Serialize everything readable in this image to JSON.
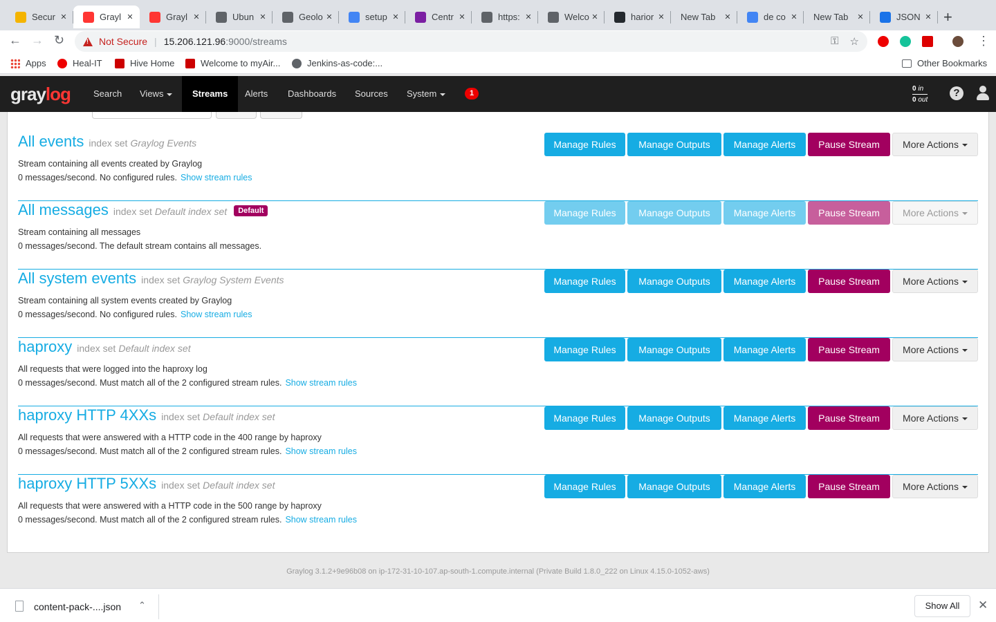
{
  "browser": {
    "tabs": [
      {
        "title": "Secur",
        "fav_color": "#f4b400",
        "active": false
      },
      {
        "title": "Grayl",
        "fav_color": "#ff3633",
        "active": true
      },
      {
        "title": "Grayl",
        "fav_color": "#ff3633",
        "active": false
      },
      {
        "title": "Ubun",
        "fav_color": "#5f6368",
        "active": false
      },
      {
        "title": "Geolo",
        "fav_color": "#5f6368",
        "active": false
      },
      {
        "title": "setup",
        "fav_color": "#4285f4",
        "active": false
      },
      {
        "title": "Centr",
        "fav_color": "#7b1fa2",
        "active": false
      },
      {
        "title": "https:",
        "fav_color": "#5f6368",
        "active": false
      },
      {
        "title": "Welco",
        "fav_color": "#5f6368",
        "active": false
      },
      {
        "title": "harior",
        "fav_color": "#24292e",
        "active": false
      },
      {
        "title": "New Tab",
        "fav_color": "",
        "active": false
      },
      {
        "title": "de co",
        "fav_color": "#4285f4",
        "active": false
      },
      {
        "title": "New Tab",
        "fav_color": "",
        "active": false
      },
      {
        "title": "JSON",
        "fav_color": "#1a73e8",
        "active": false
      }
    ],
    "new_tab_label": "+",
    "not_secure": "Not Secure",
    "url_host": "15.206.121.96",
    "url_path": ":9000/streams",
    "bookmarks": [
      {
        "label": "Apps",
        "color": "#ea4335"
      },
      {
        "label": "Heal-IT",
        "color": "#e00"
      },
      {
        "label": "Hive Home",
        "color": "#c00"
      },
      {
        "label": "Welcome to myAir...",
        "color": "#c00"
      },
      {
        "label": "Jenkins-as-code:...",
        "color": "#5f6368"
      }
    ],
    "other_bookmarks": "Other Bookmarks"
  },
  "graylog": {
    "logo_gray": "gray",
    "logo_log": "log",
    "nav": [
      {
        "label": "Search",
        "dropdown": false,
        "active": false
      },
      {
        "label": "Views",
        "dropdown": true,
        "active": false
      },
      {
        "label": "Streams",
        "dropdown": false,
        "active": true
      },
      {
        "label": "Alerts",
        "dropdown": false,
        "active": false
      },
      {
        "label": "Dashboards",
        "dropdown": false,
        "active": false
      },
      {
        "label": "Sources",
        "dropdown": false,
        "active": false
      },
      {
        "label": "System",
        "dropdown": true,
        "active": false
      }
    ],
    "notification_count": "1",
    "throughput_in_value": "0",
    "throughput_in_label": "in",
    "throughput_out_value": "0",
    "throughput_out_label": "out",
    "help_icon": "?"
  },
  "buttons": {
    "manage_rules": "Manage Rules",
    "manage_outputs": "Manage Outputs",
    "manage_alerts": "Manage Alerts",
    "pause_stream": "Pause Stream",
    "more_actions": "More Actions",
    "index_set_label": "index set",
    "show_rules": "Show stream rules"
  },
  "streams": [
    {
      "name": "All events",
      "index_set": "Graylog Events",
      "default": false,
      "desc": "Stream containing all events created by Graylog",
      "stats": "0 messages/second. No configured rules.",
      "show_rules": true,
      "disabled": false
    },
    {
      "name": "All messages",
      "index_set": "Default index set",
      "default": true,
      "desc": "Stream containing all messages",
      "stats": "0 messages/second. The default stream contains all messages.",
      "show_rules": false,
      "disabled": true
    },
    {
      "name": "All system events",
      "index_set": "Graylog System Events",
      "default": false,
      "desc": "Stream containing all system events created by Graylog",
      "stats": "0 messages/second. No configured rules.",
      "show_rules": true,
      "disabled": false
    },
    {
      "name": "haproxy",
      "index_set": "Default index set",
      "default": false,
      "desc": "All requests that were logged into the haproxy log",
      "stats": "0 messages/second. Must match all of the 2 configured stream rules.",
      "show_rules": true,
      "disabled": false
    },
    {
      "name": "haproxy HTTP 4XXs",
      "index_set": "Default index set",
      "default": false,
      "desc": "All requests that were answered with a HTTP code in the 400 range by haproxy",
      "stats": "0 messages/second. Must match all of the 2 configured stream rules.",
      "show_rules": true,
      "disabled": false
    },
    {
      "name": "haproxy HTTP 5XXs",
      "index_set": "Default index set",
      "default": false,
      "desc": "All requests that were answered with a HTTP code in the 500 range by haproxy",
      "stats": "0 messages/second. Must match all of the 2 configured stream rules.",
      "show_rules": true,
      "disabled": false
    }
  ],
  "default_badge": "Default",
  "footer": "Graylog 3.1.2+9e96b08 on ip-172-31-10-107.ap-south-1.compute.internal (Private Build 1.8.0_222 on Linux 4.15.0-1052-aws)",
  "download": {
    "filename": "content-pack-....json",
    "show_all": "Show All"
  },
  "colors": {
    "accent": "#16ace3",
    "pause": "#a2005f",
    "navbar": "#1f1f1f"
  }
}
